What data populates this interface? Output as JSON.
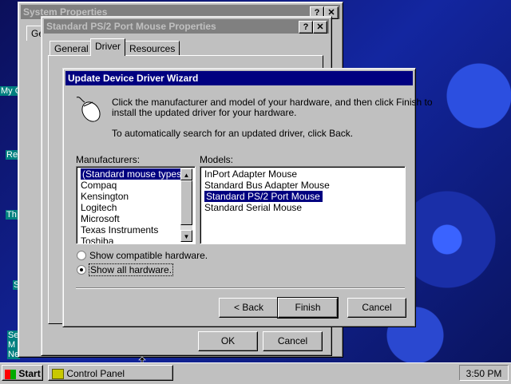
{
  "desktop": {
    "labels": [
      "My C",
      "Re",
      "Th",
      "S",
      "Se M Network"
    ]
  },
  "system_properties": {
    "title": "System Properties",
    "help_btn": "?",
    "close_btn": "✕",
    "tab_partial": "Ge"
  },
  "mouse_properties": {
    "title": "Standard PS/2 Port Mouse Properties",
    "help_btn": "?",
    "close_btn": "✕",
    "tabs": [
      "General",
      "Driver",
      "Resources"
    ],
    "ok": "OK",
    "cancel": "Cancel"
  },
  "wizard": {
    "title": "Update Device Driver Wizard",
    "instruction1": "Click the manufacturer and model of your hardware, and then click Finish to",
    "instruction2": "install the updated driver for your hardware.",
    "instruction3": "To automatically search for an updated driver, click Back.",
    "manufacturers_label": "Manufacturers:",
    "models_label": "Models:",
    "manufacturers": [
      "(Standard mouse types)",
      "Compaq",
      "Kensington",
      "Logitech",
      "Microsoft",
      "Texas Instruments",
      "Toshiba"
    ],
    "models": [
      "InPort Adapter Mouse",
      "Standard Bus Adapter Mouse",
      "Standard PS/2 Port Mouse",
      "Standard Serial Mouse"
    ],
    "radio_compatible": "Show compatible hardware.",
    "radio_all": "Show all hardware.",
    "back": "< Back",
    "finish": "Finish",
    "cancel": "Cancel"
  },
  "taskbar": {
    "start": "Start",
    "task": "Control Panel",
    "clock": "3:50 PM"
  }
}
